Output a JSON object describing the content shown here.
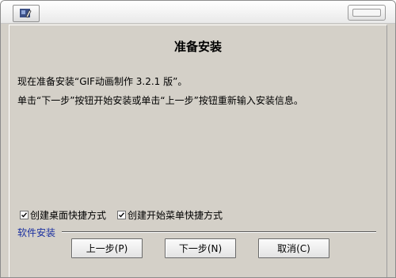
{
  "window": {
    "title": "",
    "accent_color": "#d4d0c8"
  },
  "page": {
    "heading": "准备安装",
    "line1": "现在准备安装“GIF动画制作 3.2.1 版”。",
    "line2": "单击“下一步”按钮开始安装或单击“上一步”按钮重新输入安装信息。"
  },
  "options": {
    "desktop_shortcut": {
      "label": "创建桌面快捷方式",
      "checked": true
    },
    "startmenu_shortcut": {
      "label": "创建开始菜单快捷方式",
      "checked": true
    }
  },
  "footer": {
    "group_label": "软件安装",
    "back_label": "上一步(P)",
    "next_label": "下一步(N)",
    "cancel_label": "取消(C)"
  },
  "icons": {
    "app": "installer-app-icon",
    "window_control": "window-control-icon",
    "check": "checkmark-icon"
  }
}
